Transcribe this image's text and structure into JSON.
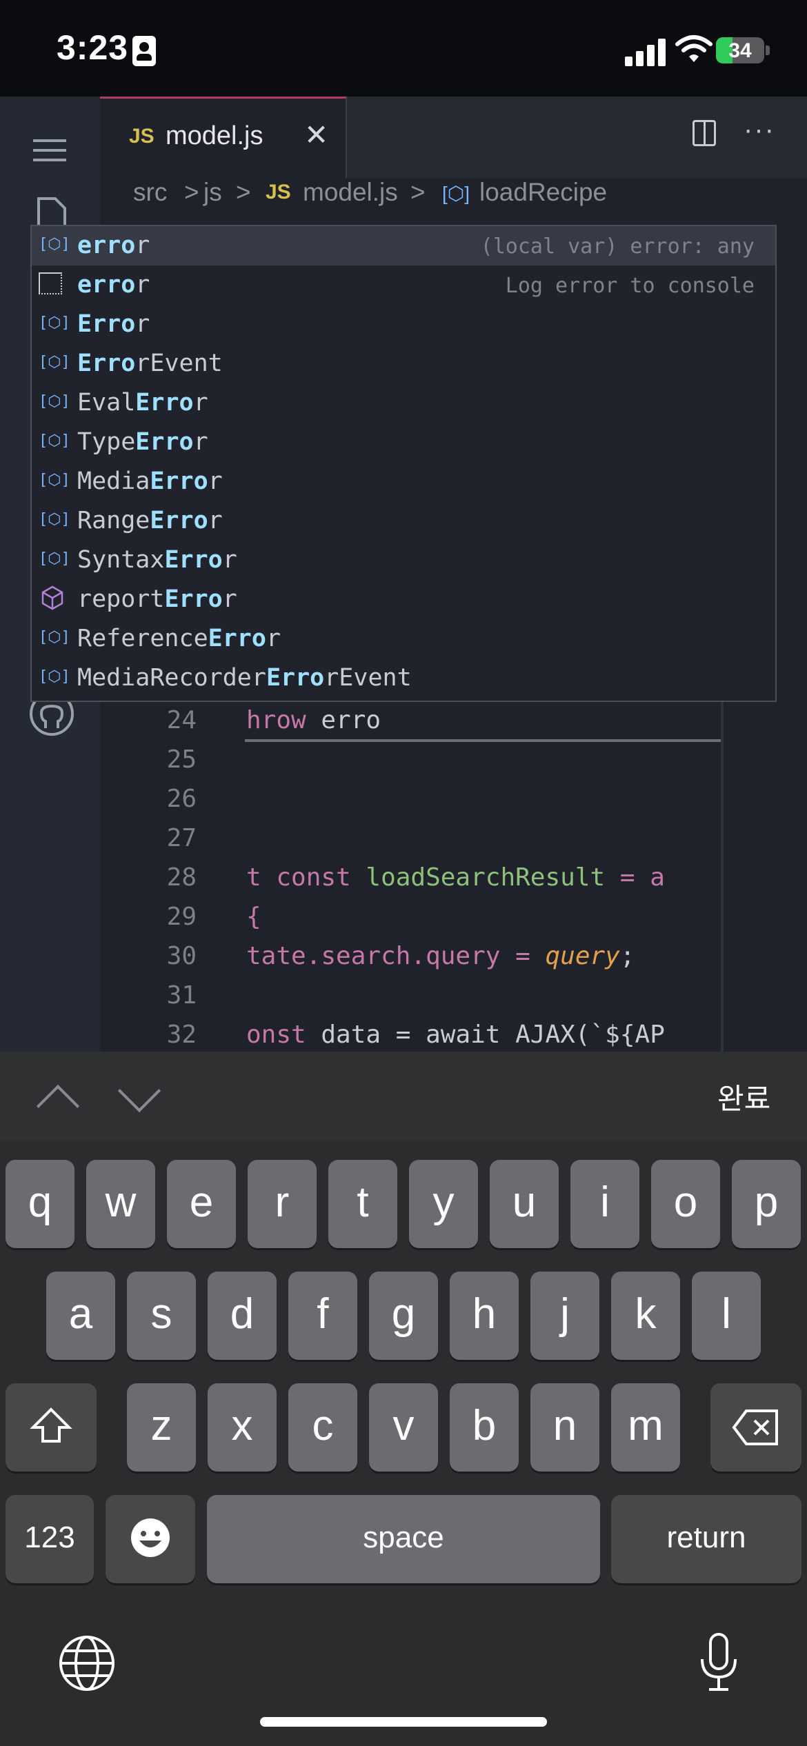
{
  "status": {
    "time": "3:23",
    "battery": "34"
  },
  "tab": {
    "lang": "JS",
    "filename": "model.js"
  },
  "breadcrumb": {
    "part1": "src",
    "part2": "js",
    "lang": "JS",
    "file": "model.js",
    "symbol": "loadRecipe"
  },
  "suggestions": [
    {
      "label_pre": "",
      "label_hl": "erro",
      "label_post": "r",
      "detail": "(local var) error: any",
      "icon": "variable-icon"
    },
    {
      "label_pre": "",
      "label_hl": "erro",
      "label_post": "r",
      "detail": "Log error to console",
      "icon": "snippet-icon"
    },
    {
      "label_pre": "",
      "label_hl": "Erro",
      "label_post": "r",
      "detail": "",
      "icon": "variable-icon"
    },
    {
      "label_pre": "",
      "label_hl": "Erro",
      "label_post": "rEvent",
      "detail": "",
      "icon": "variable-icon"
    },
    {
      "label_pre": "Eval",
      "label_hl": "Erro",
      "label_post": "r",
      "detail": "",
      "icon": "variable-icon"
    },
    {
      "label_pre": "Type",
      "label_hl": "Erro",
      "label_post": "r",
      "detail": "",
      "icon": "variable-icon"
    },
    {
      "label_pre": "Media",
      "label_hl": "Erro",
      "label_post": "r",
      "detail": "",
      "icon": "variable-icon"
    },
    {
      "label_pre": "Range",
      "label_hl": "Erro",
      "label_post": "r",
      "detail": "",
      "icon": "variable-icon"
    },
    {
      "label_pre": "Syntax",
      "label_hl": "Erro",
      "label_post": "r",
      "detail": "",
      "icon": "variable-icon"
    },
    {
      "label_pre": "report",
      "label_hl": "Erro",
      "label_post": "r",
      "detail": "",
      "icon": "method-icon"
    },
    {
      "label_pre": "Reference",
      "label_hl": "Erro",
      "label_post": "r",
      "detail": "",
      "icon": "variable-icon"
    },
    {
      "label_pre": "MediaRecorder",
      "label_hl": "Erro",
      "label_post": "rEvent",
      "detail": "",
      "icon": "variable-icon"
    }
  ],
  "code": {
    "line_numbers": [
      "24",
      "25",
      "26",
      "27",
      "28",
      "29",
      "30",
      "31",
      "32"
    ],
    "line24": {
      "kw": "hrow",
      "text": " erro"
    },
    "line28": {
      "a": "t const ",
      "fn": "loadSearchResult",
      "b": " = a"
    },
    "line29": "{",
    "line30": {
      "a": "tate.search.query = ",
      "param": "query",
      "b": ";"
    },
    "line32": {
      "a": "onst ",
      "b": "data = await AJAX(`${AP"
    }
  },
  "keyboard": {
    "done_label": "완료",
    "row1": [
      "q",
      "w",
      "e",
      "r",
      "t",
      "y",
      "u",
      "i",
      "o",
      "p"
    ],
    "row2": [
      "a",
      "s",
      "d",
      "f",
      "g",
      "h",
      "j",
      "k",
      "l"
    ],
    "row3": [
      "z",
      "x",
      "c",
      "v",
      "b",
      "n",
      "m"
    ],
    "numbers_label": "123",
    "space_label": "space",
    "return_label": "return"
  }
}
